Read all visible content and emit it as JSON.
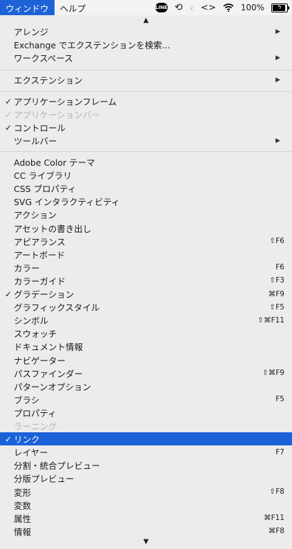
{
  "menubar": {
    "active_menu": "ウィンドウ",
    "help_menu": "ヘルプ",
    "line_label": "LINE",
    "time_machine_glyph": "⟲",
    "back_glyph": "‹",
    "code_glyph": "<>",
    "battery_percent": "100%",
    "bolt_glyph": "ϟ"
  },
  "scroll": {
    "up": "▲",
    "down": "▼"
  },
  "menu_groups": {
    "g1": [
      {
        "label": "アレンジ",
        "submenu": "▶"
      },
      {
        "label": "Exchange でエクステンションを検索..."
      },
      {
        "label": "ワークスペース",
        "submenu": "▶"
      }
    ],
    "g2": [
      {
        "label": "エクステンション",
        "submenu": "▶"
      }
    ],
    "g3": [
      {
        "check": "✓",
        "label": "アプリケーションフレーム"
      },
      {
        "check": "✓",
        "label": "アプリケーションバー",
        "disabled": true
      },
      {
        "check": "✓",
        "label": "コントロール"
      },
      {
        "label": "ツールバー",
        "submenu": "▶"
      }
    ],
    "g4": [
      {
        "label": "Adobe Color テーマ"
      },
      {
        "label": "CC ライブラリ"
      },
      {
        "label": "CSS プロパティ"
      },
      {
        "label": "SVG インタラクティビティ"
      },
      {
        "label": "アクション"
      },
      {
        "label": "アセットの書き出し"
      },
      {
        "label": "アピアランス",
        "shortcut": "⇧F6"
      },
      {
        "label": "アートボード"
      },
      {
        "label": "カラー",
        "shortcut": "F6"
      },
      {
        "label": "カラーガイド",
        "shortcut": "⇧F3"
      },
      {
        "check": "✓",
        "label": "グラデーション",
        "shortcut": "⌘F9"
      },
      {
        "label": "グラフィックスタイル",
        "shortcut": "⇧F5"
      },
      {
        "label": "シンボル",
        "shortcut": "⇧⌘F11"
      },
      {
        "label": "スウォッチ"
      },
      {
        "label": "ドキュメント情報"
      },
      {
        "label": "ナビゲーター"
      },
      {
        "label": "パスファインダー",
        "shortcut": "⇧⌘F9"
      },
      {
        "label": "パターンオプション"
      },
      {
        "label": "ブラシ",
        "shortcut": "F5"
      },
      {
        "label": "プロパティ"
      },
      {
        "label": "ラーニング",
        "disabled": true
      },
      {
        "check": "✓",
        "label": "リンク",
        "selected": true
      },
      {
        "label": "レイヤー",
        "shortcut": "F7"
      },
      {
        "label": "分割・統合プレビュー"
      },
      {
        "label": "分版プレビュー"
      },
      {
        "label": "変形",
        "shortcut": "⇧F8"
      },
      {
        "label": "変数"
      },
      {
        "label": "属性",
        "shortcut": "⌘F11"
      },
      {
        "label": "情報",
        "shortcut": "⌘F8"
      }
    ]
  }
}
